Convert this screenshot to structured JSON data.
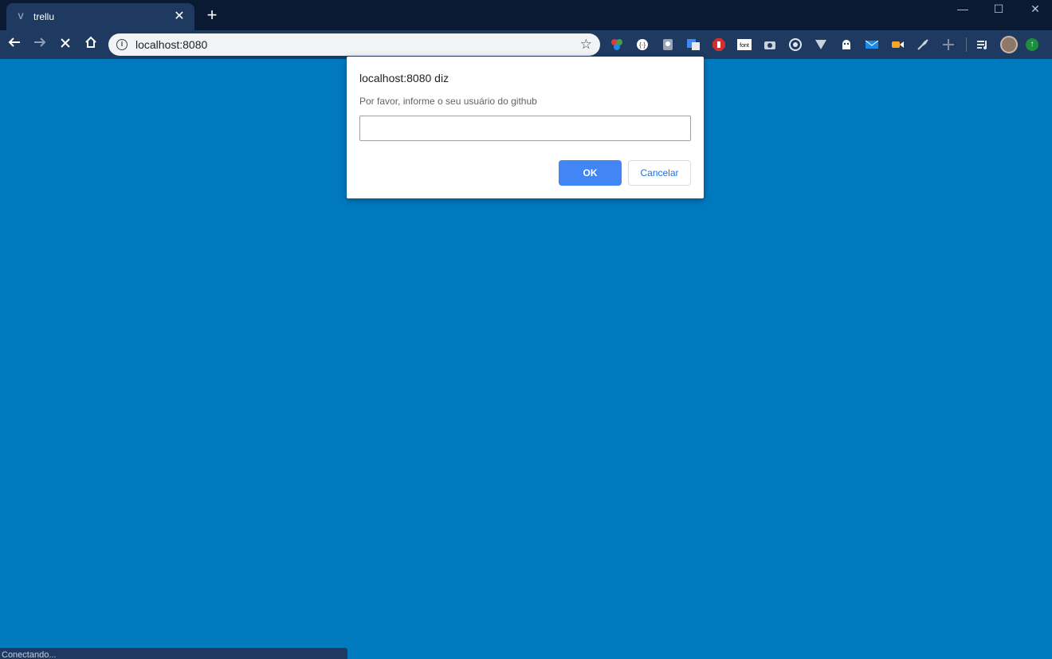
{
  "browser": {
    "tab": {
      "title": "trellu",
      "favicon": "vue-icon"
    },
    "new_tab_label": "+",
    "window_controls": [
      "—",
      "☐",
      "✕"
    ],
    "url": "localhost:8080",
    "extensions": [
      "color-picker-icon",
      "json-viewer-icon",
      "lightbulb-icon",
      "google-translate-icon",
      "adblock-icon",
      "font-icon",
      "camera-icon",
      "target-icon",
      "vue-devtools-icon",
      "ghostery-icon",
      "mail-icon",
      "video-icon",
      "feather-icon",
      "ruler-icon"
    ],
    "font_ext_label": "font"
  },
  "dialog": {
    "title": "localhost:8080 diz",
    "message": "Por favor, informe o seu usuário do github",
    "input_value": "",
    "ok_label": "OK",
    "cancel_label": "Cancelar"
  },
  "status": {
    "text": "Conectando..."
  },
  "colors": {
    "page_bg": "#0079bf",
    "toolbar_bg": "#1f3a60",
    "titlebar_bg": "#0b1a33",
    "ok_button": "#4285f4"
  }
}
